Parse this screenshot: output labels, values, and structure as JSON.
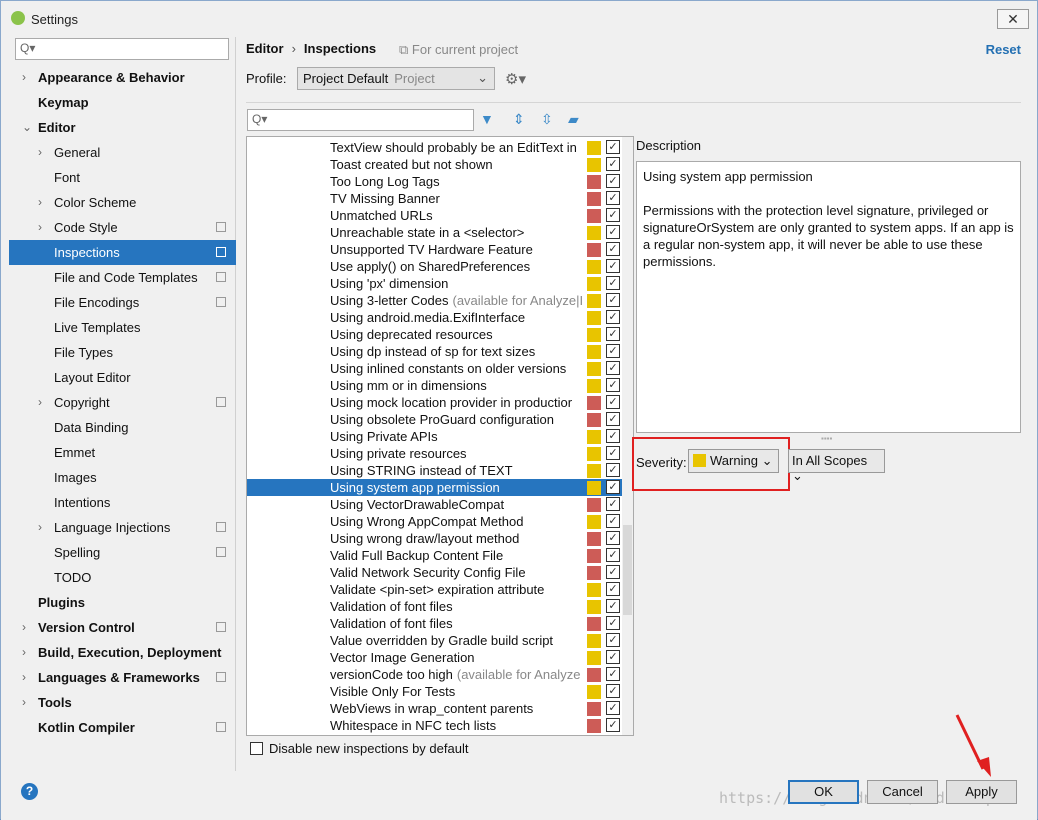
{
  "window": {
    "title": "Settings",
    "close": "✕"
  },
  "sidebar": {
    "search_placeholder": "Q▾",
    "items": [
      {
        "label": "Appearance & Behavior",
        "level": 0,
        "bold": true,
        "chevron": "›",
        "copy": false
      },
      {
        "label": "Keymap",
        "level": 0,
        "bold": true,
        "chevron": "",
        "copy": false
      },
      {
        "label": "Editor",
        "level": 0,
        "bold": true,
        "chevron": "⌄",
        "copy": false
      },
      {
        "label": "General",
        "level": 1,
        "bold": false,
        "chevron": "›",
        "copy": false
      },
      {
        "label": "Font",
        "level": 1,
        "bold": false,
        "chevron": "",
        "copy": false
      },
      {
        "label": "Color Scheme",
        "level": 1,
        "bold": false,
        "chevron": "›",
        "copy": false
      },
      {
        "label": "Code Style",
        "level": 1,
        "bold": false,
        "chevron": "›",
        "copy": true
      },
      {
        "label": "Inspections",
        "level": 1,
        "bold": false,
        "chevron": "",
        "copy": true,
        "selected": true
      },
      {
        "label": "File and Code Templates",
        "level": 1,
        "bold": false,
        "chevron": "",
        "copy": true
      },
      {
        "label": "File Encodings",
        "level": 1,
        "bold": false,
        "chevron": "",
        "copy": true
      },
      {
        "label": "Live Templates",
        "level": 1,
        "bold": false,
        "chevron": "",
        "copy": false
      },
      {
        "label": "File Types",
        "level": 1,
        "bold": false,
        "chevron": "",
        "copy": false
      },
      {
        "label": "Layout Editor",
        "level": 1,
        "bold": false,
        "chevron": "",
        "copy": false
      },
      {
        "label": "Copyright",
        "level": 1,
        "bold": false,
        "chevron": "›",
        "copy": true
      },
      {
        "label": "Data Binding",
        "level": 1,
        "bold": false,
        "chevron": "",
        "copy": false
      },
      {
        "label": "Emmet",
        "level": 1,
        "bold": false,
        "chevron": "",
        "copy": false
      },
      {
        "label": "Images",
        "level": 1,
        "bold": false,
        "chevron": "",
        "copy": false
      },
      {
        "label": "Intentions",
        "level": 1,
        "bold": false,
        "chevron": "",
        "copy": false
      },
      {
        "label": "Language Injections",
        "level": 1,
        "bold": false,
        "chevron": "›",
        "copy": true
      },
      {
        "label": "Spelling",
        "level": 1,
        "bold": false,
        "chevron": "",
        "copy": true
      },
      {
        "label": "TODO",
        "level": 1,
        "bold": false,
        "chevron": "",
        "copy": false
      },
      {
        "label": "Plugins",
        "level": 0,
        "bold": true,
        "chevron": "",
        "copy": false
      },
      {
        "label": "Version Control",
        "level": 0,
        "bold": true,
        "chevron": "›",
        "copy": true
      },
      {
        "label": "Build, Execution, Deployment",
        "level": 0,
        "bold": true,
        "chevron": "›",
        "copy": false
      },
      {
        "label": "Languages & Frameworks",
        "level": 0,
        "bold": true,
        "chevron": "›",
        "copy": true
      },
      {
        "label": "Tools",
        "level": 0,
        "bold": true,
        "chevron": "›",
        "copy": false
      },
      {
        "label": "Kotlin Compiler",
        "level": 0,
        "bold": true,
        "chevron": "",
        "copy": true
      }
    ]
  },
  "header": {
    "crumb1": "Editor",
    "crumb_sep": "›",
    "crumb2": "Inspections",
    "scope_note": "For current project",
    "reset": "Reset"
  },
  "profile": {
    "label": "Profile:",
    "value": "Project Default",
    "sub": "Project"
  },
  "filter": {
    "placeholder": "Q▾"
  },
  "colors": {
    "warning": "#e8c400",
    "error": "#cd5c57",
    "selection": "#2675bf"
  },
  "inspections": [
    {
      "t": "TextView should probably be an EditText in",
      "s": "warning"
    },
    {
      "t": "Toast created but not shown",
      "s": "warning"
    },
    {
      "t": "Too Long Log Tags",
      "s": "error"
    },
    {
      "t": "TV Missing Banner",
      "s": "error"
    },
    {
      "t": "Unmatched URLs",
      "s": "error"
    },
    {
      "t": "Unreachable state in a <selector>",
      "s": "warning"
    },
    {
      "t": "Unsupported TV Hardware Feature",
      "s": "error"
    },
    {
      "t": "Use apply() on SharedPreferences",
      "s": "warning"
    },
    {
      "t": "Using 'px' dimension",
      "s": "warning"
    },
    {
      "t": "Using 3-letter Codes",
      "n": "(available for Analyze|I",
      "s": "warning"
    },
    {
      "t": "Using android.media.ExifInterface",
      "s": "warning"
    },
    {
      "t": "Using deprecated resources",
      "s": "warning"
    },
    {
      "t": "Using dp instead of sp for text sizes",
      "s": "warning"
    },
    {
      "t": "Using inlined constants on older versions",
      "s": "warning"
    },
    {
      "t": "Using mm or in dimensions",
      "s": "warning"
    },
    {
      "t": "Using mock location provider in productior",
      "s": "error"
    },
    {
      "t": "Using obsolete ProGuard configuration",
      "s": "error"
    },
    {
      "t": "Using Private APIs",
      "s": "warning"
    },
    {
      "t": "Using private resources",
      "s": "warning"
    },
    {
      "t": "Using STRING instead of TEXT",
      "s": "warning"
    },
    {
      "t": "Using system app permission",
      "s": "warning",
      "selected": true
    },
    {
      "t": "Using VectorDrawableCompat",
      "s": "error"
    },
    {
      "t": "Using Wrong AppCompat Method",
      "s": "warning"
    },
    {
      "t": "Using wrong draw/layout method",
      "s": "error"
    },
    {
      "t": "Valid Full Backup Content File",
      "s": "error"
    },
    {
      "t": "Valid Network Security Config File",
      "s": "error"
    },
    {
      "t": "Validate <pin-set> expiration attribute",
      "s": "warning"
    },
    {
      "t": "Validation of font files",
      "s": "warning"
    },
    {
      "t": "Validation of font files",
      "s": "error"
    },
    {
      "t": "Value overridden by Gradle build script",
      "s": "warning"
    },
    {
      "t": "Vector Image Generation",
      "s": "warning"
    },
    {
      "t": "versionCode too high",
      "n": "(available for Analyze",
      "s": "error"
    },
    {
      "t": "Visible Only For Tests",
      "s": "warning"
    },
    {
      "t": "WebViews in wrap_content parents",
      "s": "error"
    },
    {
      "t": "Whitespace in NFC tech lists",
      "s": "error"
    }
  ],
  "disable_new": "Disable new inspections by default",
  "description": {
    "label": "Description",
    "title": "Using system app permission",
    "body": "Permissions with the protection level signature, privileged or signatureOrSystem are only granted to system apps. If an app is a regular non-system app, it will never be able to use these permissions."
  },
  "severity": {
    "label": "Severity:",
    "value": "Warning",
    "scope": "In All Scopes"
  },
  "footer": {
    "ok": "OK",
    "cancel": "Cancel",
    "apply": "Apply",
    "help": "?",
    "watermark": "https://blog.csdn.net/csdnzouqi"
  }
}
